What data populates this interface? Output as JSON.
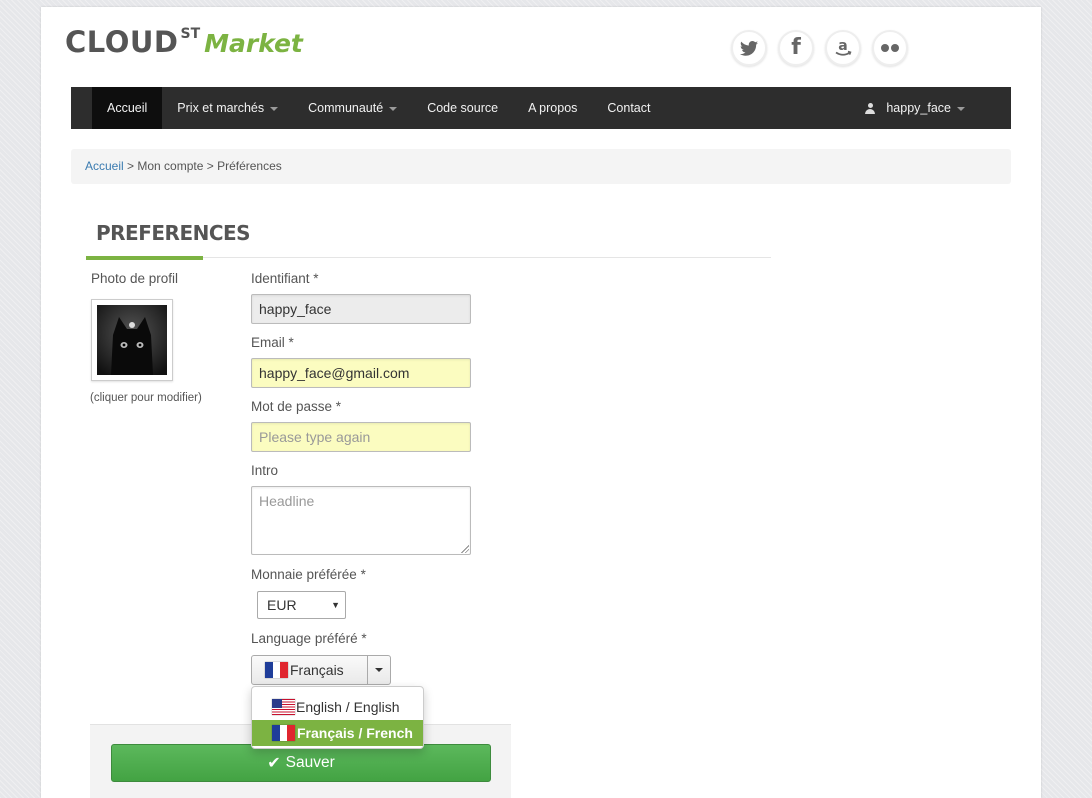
{
  "logo": {
    "brand": "CLOUD",
    "superscript": "ST",
    "product": "Market"
  },
  "social": {
    "icons": [
      {
        "name": "twitter-icon",
        "glyph": "🐦"
      },
      {
        "name": "facebook-icon",
        "glyph": "f"
      },
      {
        "name": "amazon-icon",
        "glyph": "a"
      },
      {
        "name": "flickr-icon",
        "glyph": "●●"
      }
    ]
  },
  "nav": {
    "items": [
      "Accueil",
      "Prix et marchés",
      "Communauté",
      "Code source",
      "A propos",
      "Contact"
    ],
    "user": "happy_face"
  },
  "breadcrumb": {
    "home": "Accueil",
    "rest": " > Mon compte > Préférences"
  },
  "page": {
    "title": "PREFERENCES"
  },
  "profile": {
    "label": "Photo de profil",
    "caption": "(cliquer pour modifier)"
  },
  "form": {
    "identifiant_label": "Identifiant *",
    "identifiant_value": "happy_face",
    "email_label": "Email *",
    "email_value": "happy_face@gmail.com",
    "password_label": "Mot de passe *",
    "password_placeholder": "Please type again",
    "intro_label": "Intro",
    "intro_placeholder": "Headline",
    "currency_label": "Monnaie préférée *",
    "currency_value": "EUR",
    "language_label": "Language préféré *",
    "language_value": "Français"
  },
  "language_dropdown": {
    "options": [
      "English / English",
      "Français / French"
    ],
    "selected": "Français / French"
  },
  "actions": {
    "save_label": "Sauver"
  },
  "colors": {
    "accent": "#7cb342",
    "navbar": "#2d2d2d",
    "save": "#5cb85c",
    "link": "#3a7bb0"
  }
}
